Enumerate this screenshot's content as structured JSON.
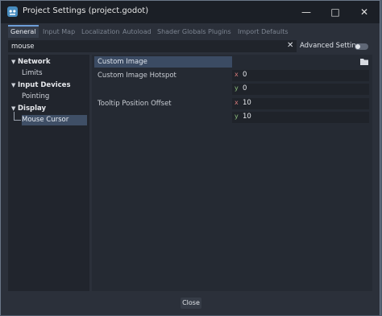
{
  "window": {
    "title": "Project Settings (project.godot)"
  },
  "tabs": [
    "General",
    "Input Map",
    "Localization",
    "Autoload",
    "Shader Globals",
    "Plugins",
    "Import Defaults"
  ],
  "search": {
    "value": "mouse"
  },
  "advanced_settings": {
    "label": "Advanced Settings",
    "enabled": false
  },
  "tree": {
    "network": "Network",
    "limits": "Limits",
    "input_devices": "Input Devices",
    "pointing": "Pointing",
    "display": "Display",
    "mouse_cursor": "Mouse Cursor"
  },
  "inspector": {
    "custom_image": "Custom Image",
    "hotspot_label": "Custom Image Hotspot",
    "hotspot_x": "0",
    "hotspot_y": "0",
    "tooltip_label": "Tooltip Position Offset",
    "tooltip_x": "10",
    "tooltip_y": "10",
    "axis_x": "x",
    "axis_y": "y"
  },
  "footer": {
    "close_label": "Close"
  },
  "colors": {
    "accent": "#6e9ed8",
    "selected_bg": "#3f4f66",
    "axis_x": "#d77a7a",
    "axis_y": "#8fc17e"
  }
}
